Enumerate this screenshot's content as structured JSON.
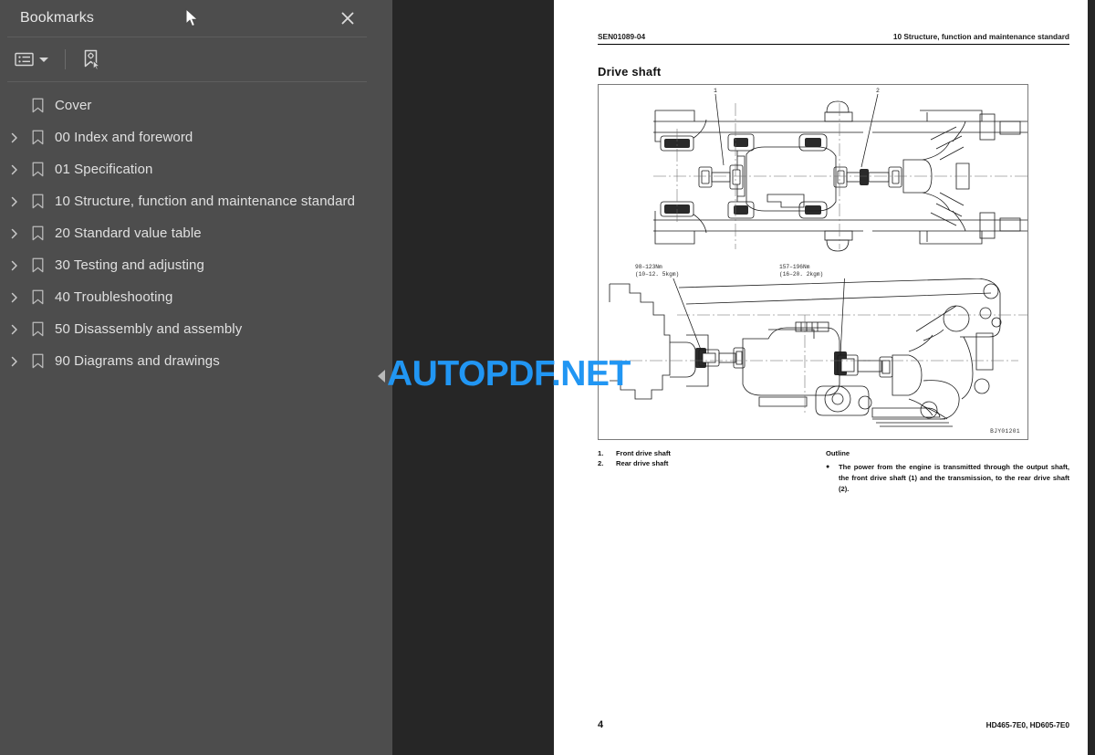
{
  "sidebar": {
    "title": "Bookmarks",
    "close_icon": "close-icon",
    "toolbar": {
      "options_label": "bookmark-options-icon",
      "new_bookmark_label": "new-bookmark-icon"
    },
    "items": [
      {
        "label": "Cover",
        "expandable": false
      },
      {
        "label": "00 Index and foreword",
        "expandable": true
      },
      {
        "label": "01 Specification",
        "expandable": true
      },
      {
        "label": "10 Structure, function and maintenance standard",
        "expandable": true
      },
      {
        "label": "20 Standard value table",
        "expandable": true
      },
      {
        "label": "30 Testing and adjusting",
        "expandable": true
      },
      {
        "label": "40 Troubleshooting",
        "expandable": true
      },
      {
        "label": "50 Disassembly and assembly",
        "expandable": true
      },
      {
        "label": "90 Diagrams and drawings",
        "expandable": true
      }
    ]
  },
  "viewer": {
    "collapse_handle": "collapse-sidebar-handle"
  },
  "page": {
    "header_left": "SEN01089-04",
    "header_right": "10 Structure, function and maintenance standard",
    "title": "Drive shaft",
    "figure": {
      "code": "BJY01201",
      "torque_1": "98–123Nm\n(10–12. 5kgm)",
      "torque_2": "157–196Nm\n(16–20. 2kgm)",
      "callout_1": "1",
      "callout_2": "2"
    },
    "legend": [
      {
        "num": "1.",
        "text": "Front drive shaft"
      },
      {
        "num": "2.",
        "text": "Rear drive shaft"
      }
    ],
    "outline": {
      "heading": "Outline",
      "bullet": "●",
      "text": "The power from the engine is transmitted through the output shaft, the front drive shaft (1) and the transmission, to the rear drive shaft (2)."
    },
    "footer_page": "4",
    "footer_model": "HD465-7E0, HD605-7E0"
  },
  "watermark": {
    "text": "AUTOPDF.NET",
    "color": "#2196f3"
  },
  "colors": {
    "sidebar_bg": "#4d4d4d",
    "viewer_bg": "#262626",
    "page_bg": "#ffffff",
    "text": "#e0e0e0"
  }
}
